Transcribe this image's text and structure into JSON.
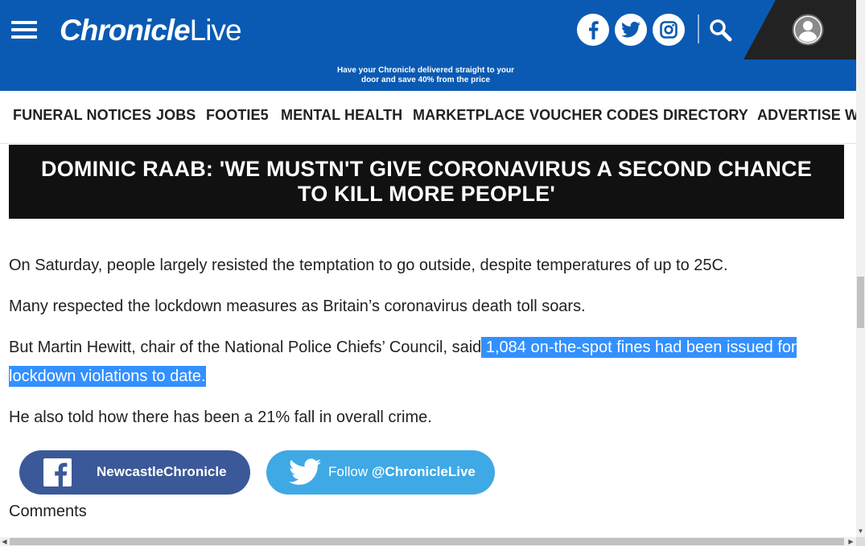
{
  "header": {
    "logo_bold": "Chronicle",
    "logo_light": "Live",
    "promo_line1": "Have your Chronicle delivered straight to your",
    "promo_line2": "door and save 40% from the price",
    "background_color": "#0a5ab3",
    "icons": [
      "menu-icon",
      "facebook-icon",
      "twitter-icon",
      "instagram-icon",
      "search-icon",
      "account-icon"
    ]
  },
  "nav": {
    "items": [
      "FUNERAL NOTICES",
      "JOBS",
      "FOOTIE5",
      "MENTAL HEALTH",
      "MARKETPLACE",
      "VOUCHER CODES",
      "DIRECTORY",
      "ADVERTISE WI"
    ]
  },
  "banner": {
    "title": "DOMINIC RAAB: 'WE MUSTN'T GIVE CORONAVIRUS A SECOND CHANCE TO KILL MORE PEOPLE'"
  },
  "article": {
    "p1": "On Saturday, people largely resisted the temptation to go outside, despite temperatures of up to 25C.",
    "p2": "Many respected the lockdown measures as Britain’s coronavirus death toll soars.",
    "p3_plain": "But Martin Hewitt, chair of the National Police Chiefs’ Council, said",
    "p3_selected_a": "1,084 on-the-spot fines had been issued for",
    "p3_selected_b": "lockdown violations to date.",
    "p4": "He also told how there has been a 21% fall in overall crime.",
    "selection_color": "#3390ff"
  },
  "follow": {
    "facebook_label": "NewcastleChronicle",
    "twitter_prefix": "Follow ",
    "twitter_handle": "@ChronicleLive",
    "facebook_color": "#3b5998",
    "twitter_color": "#3fa9e5"
  },
  "comments": {
    "label": "Comments"
  }
}
